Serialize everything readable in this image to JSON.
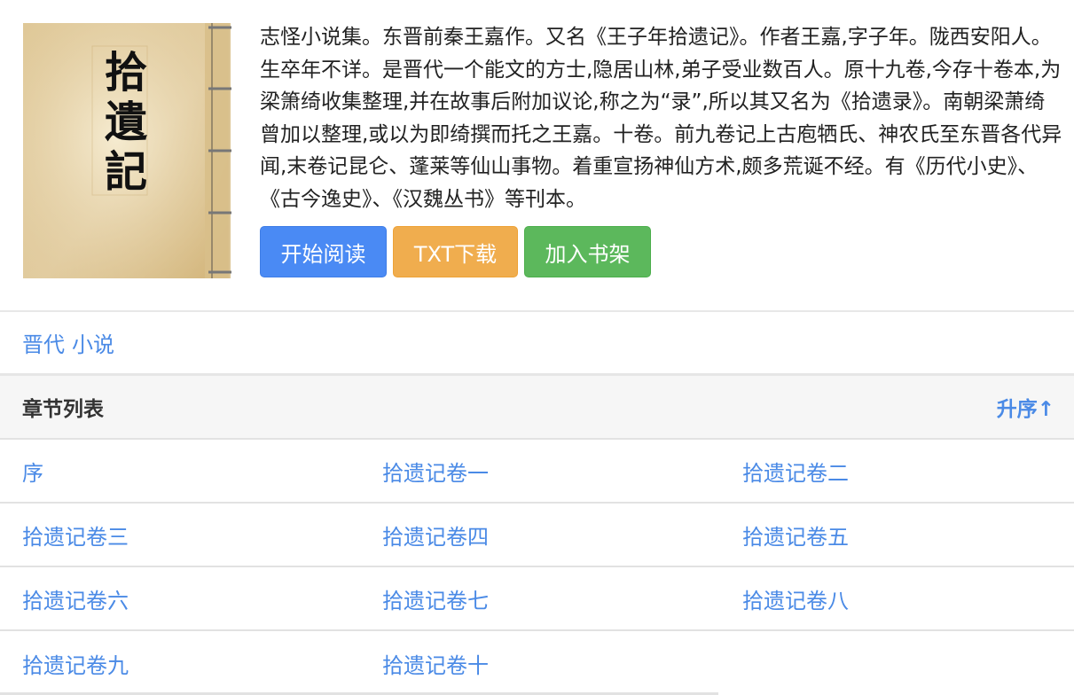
{
  "book": {
    "cover_title_chars": [
      "拾",
      "遺",
      "記"
    ],
    "description": "志怪小说集。东晋前秦王嘉作。又名《王子年拾遗记》。作者王嘉,字子年。陇西安阳人。生卒年不详。是晋代一个能文的方士,隐居山林,弟子受业数百人。原十九卷,今存十卷本,为梁箫绮收集整理,并在故事后附加议论,称之为“录”,所以其又名为《拾遗录》。南朝梁萧绮曾加以整理,或以为即绮撰而托之王嘉。十卷。前九卷记上古庖牺氏、神农氏至东晋各代异闻,末卷记昆仑、蓬莱等仙山事物。着重宣扬神仙方术,颇多荒诞不经。有《历代小史》、《古今逸史》、《汉魏丛书》等刊本。",
    "actions": {
      "read": "开始阅读",
      "download": "TXT下载",
      "shelf": "加入书架"
    }
  },
  "tags": [
    "晋代",
    "小说"
  ],
  "chapters": {
    "header": "章节列表",
    "sort": "升序↑",
    "rows": [
      [
        "序",
        "拾遗记卷一",
        "拾遗记卷二"
      ],
      [
        "拾遗记卷三",
        "拾遗记卷四",
        "拾遗记卷五"
      ],
      [
        "拾遗记卷六",
        "拾遗记卷七",
        "拾遗记卷八"
      ],
      [
        "拾遗记卷九",
        "拾遗记卷十",
        ""
      ]
    ]
  },
  "colors": {
    "link": "#4a8ae6",
    "read_button": "#4a8af4",
    "download_button": "#f0ad4e",
    "shelf_button": "#5cb85c"
  }
}
